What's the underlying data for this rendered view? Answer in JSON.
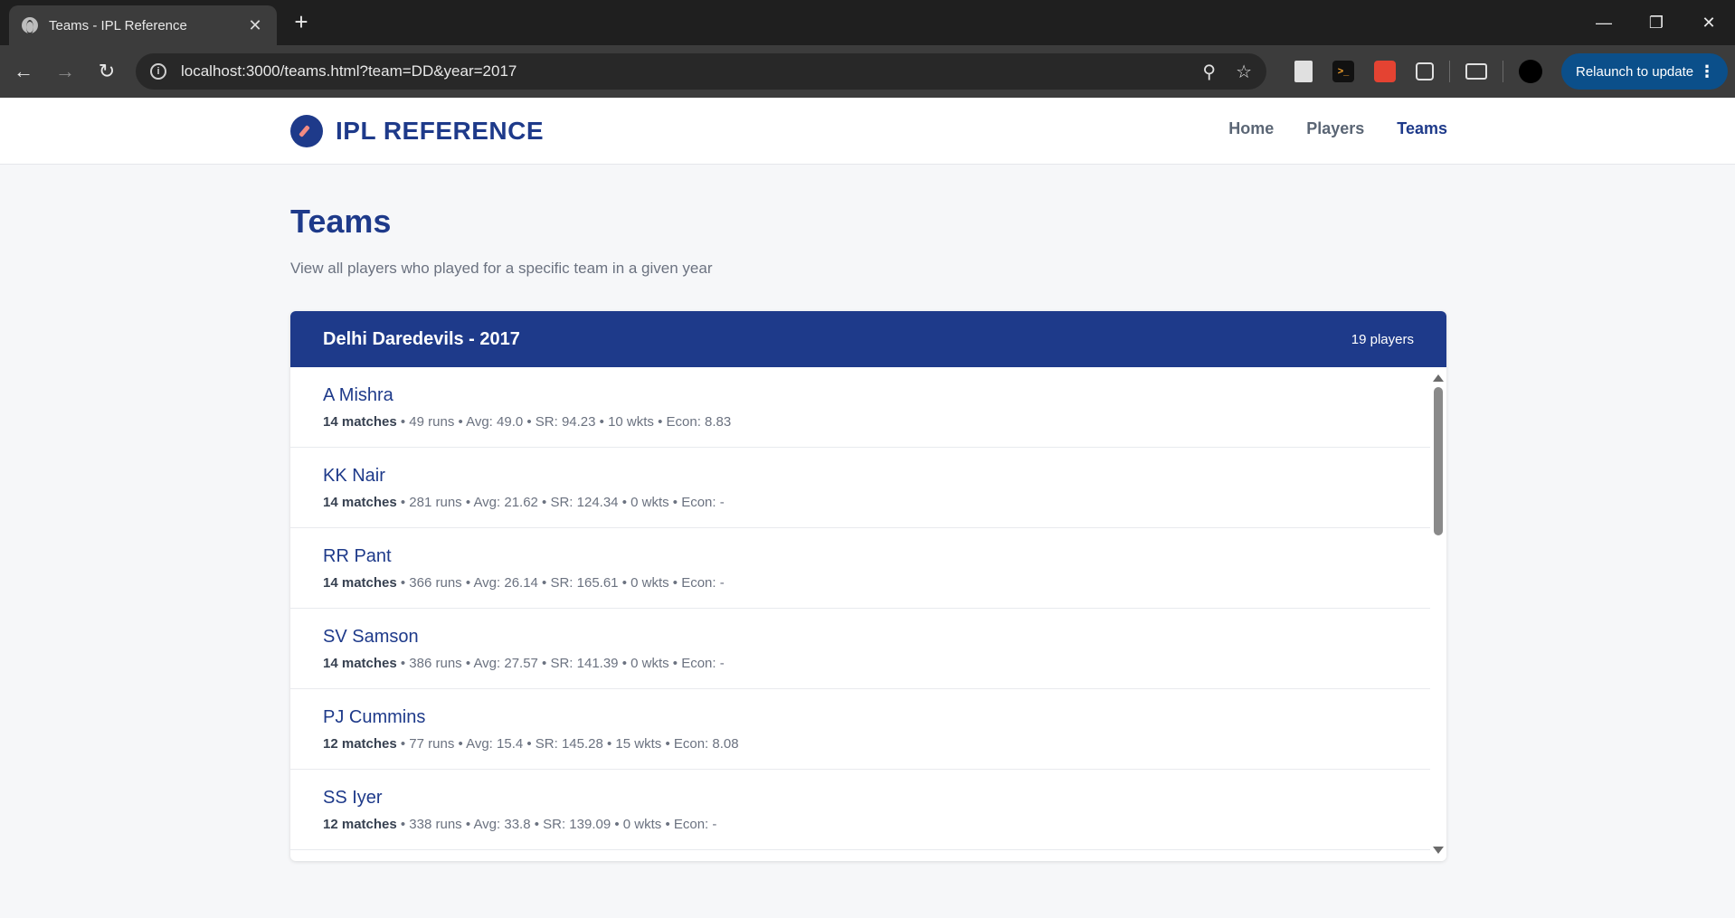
{
  "browser": {
    "tab_title": "Teams - IPL Reference",
    "url": "localhost:3000/teams.html?team=DD&year=2017",
    "relaunch_label": "Relaunch to update"
  },
  "site": {
    "brand": "IPL REFERENCE",
    "nav": [
      {
        "label": "Home",
        "active": false
      },
      {
        "label": "Players",
        "active": false
      },
      {
        "label": "Teams",
        "active": true
      }
    ]
  },
  "page": {
    "title": "Teams",
    "subtitle": "View all players who played for a specific team in a given year"
  },
  "team_card": {
    "title": "Delhi Daredevils - 2017",
    "player_count": "19 players",
    "players": [
      {
        "name": "A Mishra",
        "matches": "14 matches",
        "stats": " • 49 runs • Avg: 49.0 • SR: 94.23 • 10 wkts • Econ: 8.83"
      },
      {
        "name": "KK Nair",
        "matches": "14 matches",
        "stats": " • 281 runs • Avg: 21.62 • SR: 124.34 • 0 wkts • Econ: -"
      },
      {
        "name": "RR Pant",
        "matches": "14 matches",
        "stats": " • 366 runs • Avg: 26.14 • SR: 165.61 • 0 wkts • Econ: -"
      },
      {
        "name": "SV Samson",
        "matches": "14 matches",
        "stats": " • 386 runs • Avg: 27.57 • SR: 141.39 • 0 wkts • Econ: -"
      },
      {
        "name": "PJ Cummins",
        "matches": "12 matches",
        "stats": " • 77 runs • Avg: 15.4 • SR: 145.28 • 15 wkts • Econ: 8.08"
      },
      {
        "name": "SS Iyer",
        "matches": "12 matches",
        "stats": " • 338 runs • Avg: 33.8 • SR: 139.09 • 0 wkts • Econ: -"
      }
    ]
  }
}
